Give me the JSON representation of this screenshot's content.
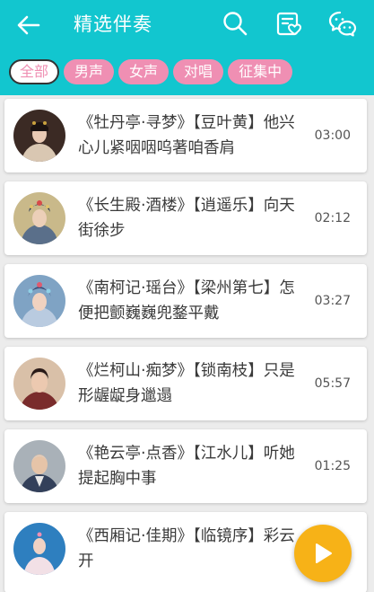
{
  "header": {
    "title": "精选伴奏",
    "back_icon": "arrow-left-icon",
    "icons": [
      "search-icon",
      "favorites-list-icon",
      "wechat-icon"
    ],
    "background": "#12c6cf"
  },
  "filters": [
    {
      "label": "全部",
      "selected": true
    },
    {
      "label": "男声",
      "selected": false
    },
    {
      "label": "女声",
      "selected": false
    },
    {
      "label": "对唱",
      "selected": false
    },
    {
      "label": "征集中",
      "selected": false
    }
  ],
  "songs": [
    {
      "title": "《牡丹亭·寻梦》【豆叶黄】他兴心儿紧咽咽呜著咱香肩",
      "duration": "03:00"
    },
    {
      "title": "《长生殿·酒楼》【逍遥乐】向天街徐步",
      "duration": "02:12"
    },
    {
      "title": "《南柯记·瑶台》【梁州第七】怎便把颤巍巍兜鍪平戴",
      "duration": "03:27"
    },
    {
      "title": "《烂柯山·痴梦》【锁南枝】只是形龌龊身邋遢",
      "duration": "05:57"
    },
    {
      "title": "《艳云亭·点香》【江水儿】听她提起胸中事",
      "duration": "01:25"
    },
    {
      "title": "《西厢记·佳期》【临镜序】彩云开",
      "duration": ""
    }
  ],
  "play_button": {
    "icon": "play-icon",
    "color": "#f7b217"
  },
  "colors": {
    "chip": "#ef8fb3",
    "accent": "#12c6cf"
  }
}
